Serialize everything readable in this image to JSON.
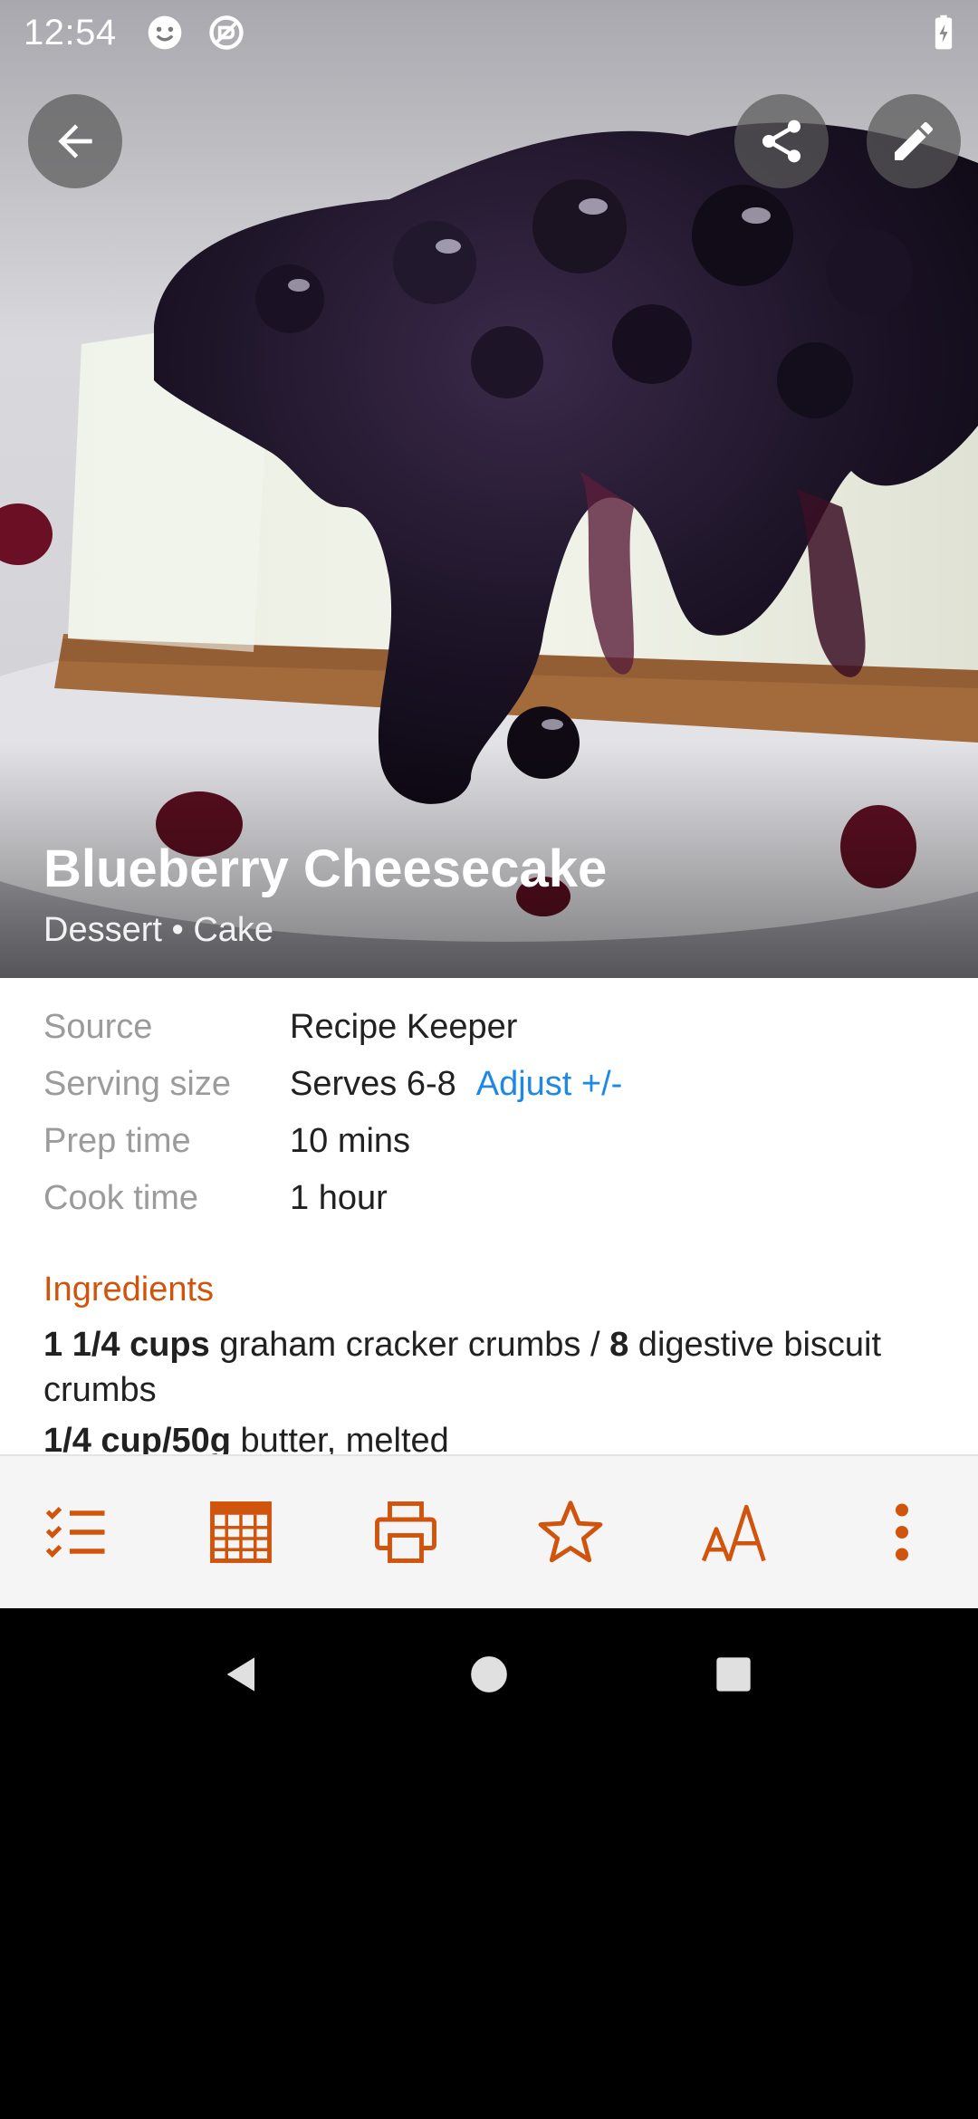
{
  "status_bar": {
    "time": "12:54",
    "icons": [
      "face-icon",
      "sync-icon",
      "battery-charging-icon"
    ]
  },
  "hero": {
    "title": "Blueberry Cheesecake",
    "subtitle": "Dessert • Cake",
    "image": "blueberry-cheesecake-photo",
    "buttons": [
      "back-icon",
      "share-icon",
      "edit-icon"
    ]
  },
  "details": {
    "rows": [
      {
        "label": "Source",
        "value": "Recipe Keeper"
      },
      {
        "label": "Serving size",
        "value": "Serves 6-8",
        "link": "Adjust +/-"
      },
      {
        "label": "Prep time",
        "value": "10 mins"
      },
      {
        "label": "Cook time",
        "value": "1 hour"
      }
    ],
    "ingredients_heading": "Ingredients",
    "ingredients": [
      {
        "amount": "1 1/4 cups",
        "text_a": " graham cracker crumbs / ",
        "amount_b": "8",
        "text_b": " digestive biscuit crumbs"
      },
      {
        "amount": "1/4 cup/50g",
        "text_a": " butter, melted"
      }
    ]
  },
  "toolbar": {
    "accent": "#d1540d",
    "buttons": [
      "checklist-icon",
      "calendar-icon",
      "print-icon",
      "star-icon",
      "font-size-icon",
      "more-vert-icon"
    ]
  },
  "nav_bar": {
    "buttons": [
      "back-triangle-icon",
      "home-circle-icon",
      "recents-square-icon"
    ]
  },
  "colors": {
    "accent": "#d1540d",
    "link": "#1e88e5",
    "label": "#9b9b9b",
    "text": "#212121"
  }
}
